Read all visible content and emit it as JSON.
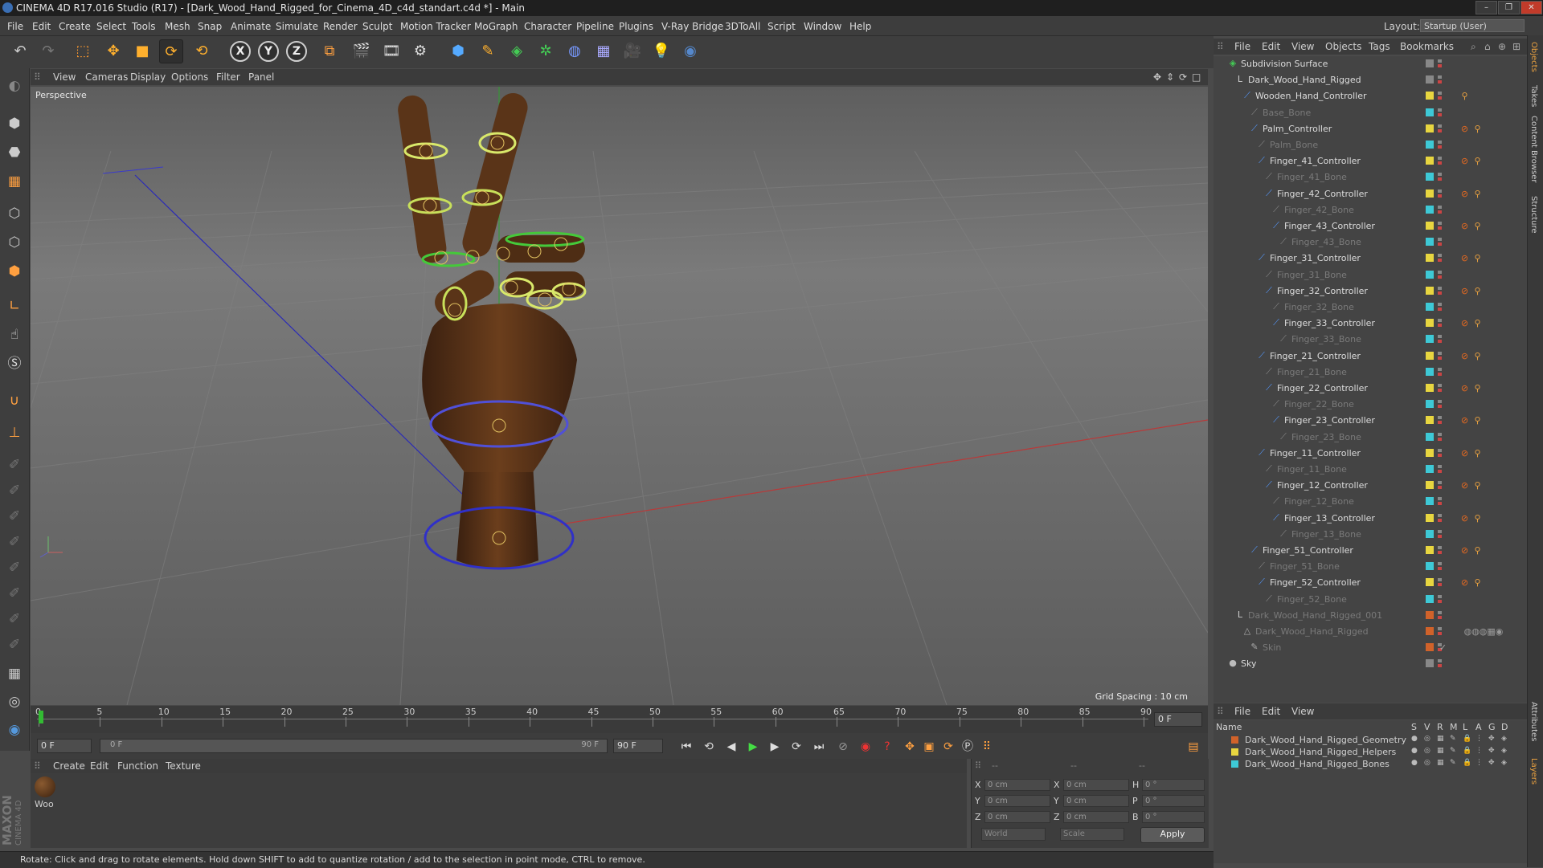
{
  "window": {
    "title": "CINEMA 4D R17.016 Studio (R17) - [Dark_Wood_Hand_Rigged_for_Cinema_4D_c4d_standart.c4d *] - Main",
    "controls": [
      "–",
      "❐",
      "✕"
    ]
  },
  "menubar": {
    "items": [
      "File",
      "Edit",
      "Create",
      "Select",
      "Tools",
      "Mesh",
      "Snap",
      "Animate",
      "Simulate",
      "Render",
      "Sculpt",
      "Motion Tracker",
      "MoGraph",
      "Character",
      "Pipeline",
      "Plugins",
      "V-Ray Bridge",
      "3DToAll",
      "Script",
      "Window",
      "Help"
    ],
    "layout_label": "Layout:",
    "layout_value": "Startup (User)"
  },
  "toolbar": {
    "axis_x": "X",
    "axis_y": "Y",
    "axis_z": "Z"
  },
  "viewport": {
    "menu": [
      "View",
      "Cameras",
      "Display",
      "Options",
      "Filter",
      "Panel"
    ],
    "camera_label": "Perspective",
    "grid_spacing": "Grid Spacing : 10 cm",
    "accent_colors": {
      "ring_yellow": "#d9e86a",
      "ring_green": "#45c93a",
      "ring_blue": "#3030c8",
      "wood": "#5a3418"
    }
  },
  "timeline": {
    "ticks": [
      "0",
      "5",
      "10",
      "15",
      "20",
      "25",
      "30",
      "35",
      "40",
      "45",
      "50",
      "55",
      "60",
      "65",
      "70",
      "75",
      "80",
      "85",
      "90"
    ],
    "current_frame_field": "0 F",
    "start_field": "0 F",
    "range_start": "0 F",
    "range_end": "90 F",
    "end_field": "90 F"
  },
  "material_manager": {
    "menu": [
      "Create",
      "Edit",
      "Function",
      "Texture"
    ],
    "materials": [
      {
        "name": "Woo"
      }
    ]
  },
  "coordinates": {
    "headers": [
      "--",
      "--",
      "--"
    ],
    "rows": [
      {
        "axis": "X",
        "pos": "0 cm",
        "axis2": "X",
        "size": "0 cm",
        "axis3": "H",
        "rot": "0 °"
      },
      {
        "axis": "Y",
        "pos": "0 cm",
        "axis2": "Y",
        "size": "0 cm",
        "axis3": "P",
        "rot": "0 °"
      },
      {
        "axis": "Z",
        "pos": "0 cm",
        "axis2": "Z",
        "size": "0 cm",
        "axis3": "B",
        "rot": "0 °"
      }
    ],
    "world_select": "World",
    "scale_select": "Scale",
    "apply_label": "Apply"
  },
  "status": {
    "text": "Rotate: Click and drag to rotate elements. Hold down SHIFT to add to quantize rotation / add to the selection in point mode, CTRL to remove."
  },
  "branding": {
    "maxon": "MAXON",
    "cinema": "CINEMA 4D"
  },
  "object_manager": {
    "menu": [
      "File",
      "Edit",
      "View",
      "Objects",
      "Tags",
      "Bookmarks"
    ],
    "objects": [
      {
        "name": "Subdivision Surface",
        "type": "subdiv",
        "dim": false,
        "vis": "#888888",
        "tags": ""
      },
      {
        "name": "Dark_Wood_Hand_Rigged",
        "type": "null",
        "dim": false,
        "vis": "#888888",
        "tags": ""
      },
      {
        "name": "Wooden_Hand_Controller",
        "type": "joint",
        "dim": false,
        "vis": "#e8d640",
        "tags": "ik"
      },
      {
        "name": "Base_Bone",
        "type": "bone",
        "dim": true,
        "vis": "#3ec9d6",
        "tags": ""
      },
      {
        "name": "Palm_Controller",
        "type": "joint",
        "dim": false,
        "vis": "#e8d640",
        "tags": "pin-ik"
      },
      {
        "name": "Palm_Bone",
        "type": "bone",
        "dim": true,
        "vis": "#3ec9d6",
        "tags": ""
      },
      {
        "name": "Finger_41_Controller",
        "type": "joint",
        "dim": false,
        "vis": "#e8d640",
        "tags": "pin-ik"
      },
      {
        "name": "Finger_41_Bone",
        "type": "bone",
        "dim": true,
        "vis": "#3ec9d6",
        "tags": ""
      },
      {
        "name": "Finger_42_Controller",
        "type": "joint",
        "dim": false,
        "vis": "#e8d640",
        "tags": "pin-ik"
      },
      {
        "name": "Finger_42_Bone",
        "type": "bone",
        "dim": true,
        "vis": "#3ec9d6",
        "tags": ""
      },
      {
        "name": "Finger_43_Controller",
        "type": "joint",
        "dim": false,
        "vis": "#e8d640",
        "tags": "pin-ik"
      },
      {
        "name": "Finger_43_Bone",
        "type": "bone",
        "dim": true,
        "vis": "#3ec9d6",
        "tags": ""
      },
      {
        "name": "Finger_31_Controller",
        "type": "joint",
        "dim": false,
        "vis": "#e8d640",
        "tags": "pin-ik"
      },
      {
        "name": "Finger_31_Bone",
        "type": "bone",
        "dim": true,
        "vis": "#3ec9d6",
        "tags": ""
      },
      {
        "name": "Finger_32_Controller",
        "type": "joint",
        "dim": false,
        "vis": "#e8d640",
        "tags": "pin-ik"
      },
      {
        "name": "Finger_32_Bone",
        "type": "bone",
        "dim": true,
        "vis": "#3ec9d6",
        "tags": ""
      },
      {
        "name": "Finger_33_Controller",
        "type": "joint",
        "dim": false,
        "vis": "#e8d640",
        "tags": "pin-ik"
      },
      {
        "name": "Finger_33_Bone",
        "type": "bone",
        "dim": true,
        "vis": "#3ec9d6",
        "tags": ""
      },
      {
        "name": "Finger_21_Controller",
        "type": "joint",
        "dim": false,
        "vis": "#e8d640",
        "tags": "pin-ik"
      },
      {
        "name": "Finger_21_Bone",
        "type": "bone",
        "dim": true,
        "vis": "#3ec9d6",
        "tags": ""
      },
      {
        "name": "Finger_22_Controller",
        "type": "joint",
        "dim": false,
        "vis": "#e8d640",
        "tags": "pin-ik"
      },
      {
        "name": "Finger_22_Bone",
        "type": "bone",
        "dim": true,
        "vis": "#3ec9d6",
        "tags": ""
      },
      {
        "name": "Finger_23_Controller",
        "type": "joint",
        "dim": false,
        "vis": "#e8d640",
        "tags": "pin-ik"
      },
      {
        "name": "Finger_23_Bone",
        "type": "bone",
        "dim": true,
        "vis": "#3ec9d6",
        "tags": ""
      },
      {
        "name": "Finger_11_Controller",
        "type": "joint",
        "dim": false,
        "vis": "#e8d640",
        "tags": "pin-ik"
      },
      {
        "name": "Finger_11_Bone",
        "type": "bone",
        "dim": true,
        "vis": "#3ec9d6",
        "tags": ""
      },
      {
        "name": "Finger_12_Controller",
        "type": "joint",
        "dim": false,
        "vis": "#e8d640",
        "tags": "pin-ik"
      },
      {
        "name": "Finger_12_Bone",
        "type": "bone",
        "dim": true,
        "vis": "#3ec9d6",
        "tags": ""
      },
      {
        "name": "Finger_13_Controller",
        "type": "joint",
        "dim": false,
        "vis": "#e8d640",
        "tags": "pin-ik"
      },
      {
        "name": "Finger_13_Bone",
        "type": "bone",
        "dim": true,
        "vis": "#3ec9d6",
        "tags": ""
      },
      {
        "name": "Finger_51_Controller",
        "type": "joint",
        "dim": false,
        "vis": "#e8d640",
        "tags": "pin-ik"
      },
      {
        "name": "Finger_51_Bone",
        "type": "bone",
        "dim": true,
        "vis": "#3ec9d6",
        "tags": ""
      },
      {
        "name": "Finger_52_Controller",
        "type": "joint",
        "dim": false,
        "vis": "#e8d640",
        "tags": "pin-ik"
      },
      {
        "name": "Finger_52_Bone",
        "type": "bone",
        "dim": true,
        "vis": "#3ec9d6",
        "tags": ""
      },
      {
        "name": "Dark_Wood_Hand_Rigged_001",
        "type": "null",
        "dim": true,
        "vis": "#d0622a",
        "tags": ""
      },
      {
        "name": "Dark_Wood_Hand_Rigged",
        "type": "mesh",
        "dim": true,
        "vis": "#d0622a",
        "tags": "mat"
      },
      {
        "name": "Skin",
        "type": "skin",
        "dim": true,
        "vis": "#d0622a",
        "tags": "check"
      },
      {
        "name": "Sky",
        "type": "sky",
        "dim": false,
        "vis": "#888888",
        "tags": ""
      }
    ]
  },
  "layer_manager": {
    "menu": [
      "File",
      "Edit",
      "View"
    ],
    "columns": [
      "Name",
      "S",
      "V",
      "R",
      "M",
      "L",
      "A",
      "G",
      "D"
    ],
    "layers": [
      {
        "name": "Dark_Wood_Hand_Rigged_Geometry",
        "color": "#d0622a"
      },
      {
        "name": "Dark_Wood_Hand_Rigged_Helpers",
        "color": "#e8d640"
      },
      {
        "name": "Dark_Wood_Hand_Rigged_Bones",
        "color": "#3ec9d6"
      }
    ]
  },
  "right_tabs": [
    "Objects",
    "Takes",
    "Content Browser",
    "Structure",
    "Attributes",
    "Layers"
  ]
}
